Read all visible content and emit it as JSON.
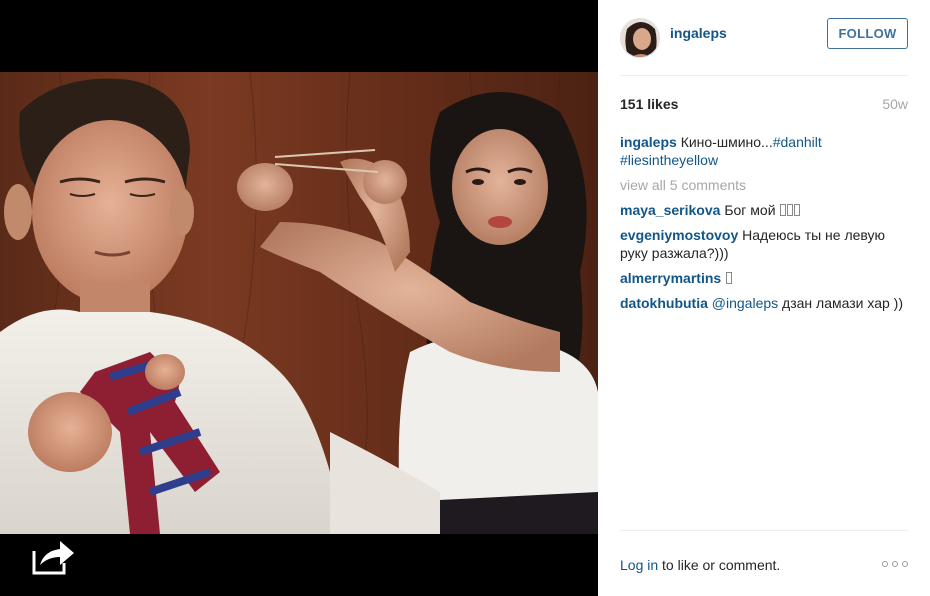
{
  "post": {
    "username": "ingaleps",
    "follow_label": "FOLLOW",
    "likes": "151 likes",
    "age": "50w",
    "caption": {
      "user": "ingaleps",
      "text": "Кино-шмино...",
      "hashtag1": "#danhilt",
      "hashtag2": "#liesintheyellow"
    },
    "view_all": "view all 5 comments",
    "comments": [
      {
        "user": "maya_serikova",
        "text": "Бог мой"
      },
      {
        "user": "evgeniymostovoy",
        "text": "Надеюсь ты не левую руку разжала?)))"
      },
      {
        "user": "almerrymartins",
        "text": ""
      },
      {
        "user": "datokhubutia",
        "mention": "@ingaleps",
        "text": "дзан ламази хар ))"
      }
    ]
  },
  "footer": {
    "login_label": "Log in",
    "login_suffix": " to like or comment."
  },
  "icons": {
    "share": "share-arrow-icon",
    "more": "more-options-icon"
  },
  "colors": {
    "link": "#125688",
    "follow": "#3f729b",
    "muted": "#a5a7aa",
    "text": "#262626"
  }
}
